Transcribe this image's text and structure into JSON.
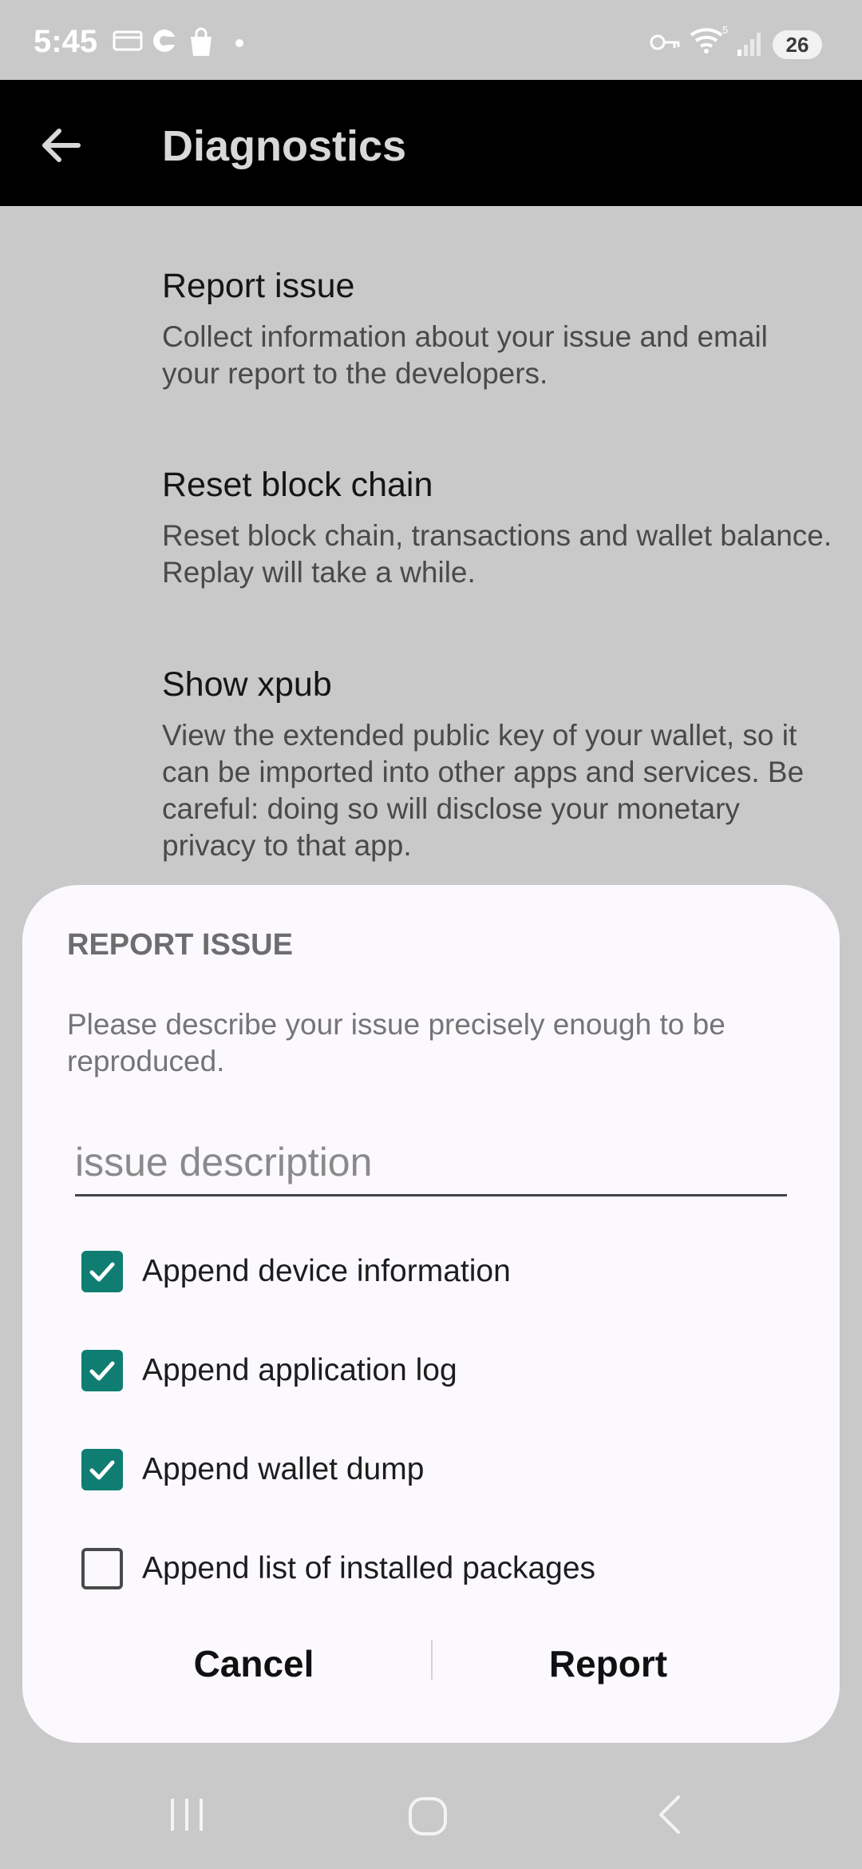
{
  "status_bar": {
    "time": "5:45",
    "battery": "26",
    "icons": [
      "card-icon",
      "sync-icon",
      "shopping-bag-icon",
      "dot-icon",
      "key-icon",
      "wifi-icon",
      "signal-icon"
    ]
  },
  "app_bar": {
    "title": "Diagnostics",
    "back_icon": "arrow-left-icon"
  },
  "settings": [
    {
      "title": "Report issue",
      "summary": "Collect information about your issue and email your report to the developers."
    },
    {
      "title": "Reset block chain",
      "summary": "Reset block chain, transactions and wallet balance. Replay will take a while."
    },
    {
      "title": "Show xpub",
      "summary": "View the extended public key of your wallet, so it can be imported into other apps and services. Be careful: doing so will disclose your monetary privacy to that app."
    }
  ],
  "dialog": {
    "title": "REPORT ISSUE",
    "message": "Please describe your issue precisely enough to be reproduced.",
    "input": {
      "placeholder": "issue description",
      "value": ""
    },
    "options": [
      {
        "label": "Append device information",
        "checked": true
      },
      {
        "label": "Append application log",
        "checked": true
      },
      {
        "label": "Append wallet dump",
        "checked": true
      },
      {
        "label": "Append list of installed packages",
        "checked": false
      }
    ],
    "cancel_label": "Cancel",
    "report_label": "Report"
  },
  "colors": {
    "accent": "#0f7d72",
    "app_bar": "#000000",
    "dim_background": "#c9c9c9",
    "dialog_background": "#fbf9fe"
  },
  "nav_bar": {
    "icons": [
      "recent-apps-icon",
      "home-icon",
      "back-nav-icon"
    ]
  }
}
